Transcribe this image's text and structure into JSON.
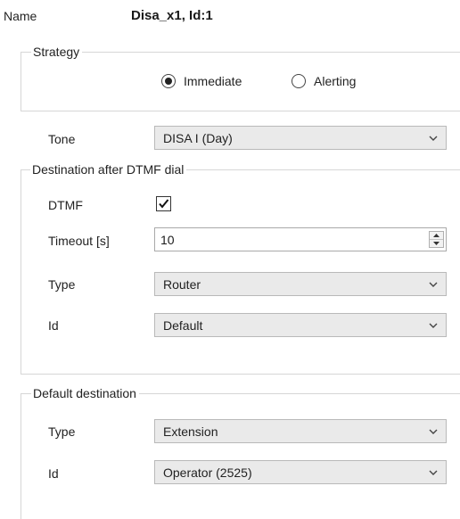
{
  "header": {
    "name_label": "Name",
    "name_value": "Disa_x1, Id:1"
  },
  "strategy": {
    "legend": "Strategy",
    "options": [
      {
        "label": "Immediate",
        "selected": true
      },
      {
        "label": "Alerting",
        "selected": false
      }
    ]
  },
  "tone": {
    "label": "Tone",
    "value": "DISA I (Day)"
  },
  "dtmf_destination": {
    "legend": "Destination after DTMF dial",
    "dtmf": {
      "label": "DTMF",
      "checked": true
    },
    "timeout": {
      "label": "Timeout [s]",
      "value": "10"
    },
    "type": {
      "label": "Type",
      "value": "Router"
    },
    "id": {
      "label": "Id",
      "value": "Default"
    }
  },
  "default_destination": {
    "legend": "Default destination",
    "type": {
      "label": "Type",
      "value": "Extension"
    },
    "id": {
      "label": "Id",
      "value": "Operator (2525)"
    }
  }
}
